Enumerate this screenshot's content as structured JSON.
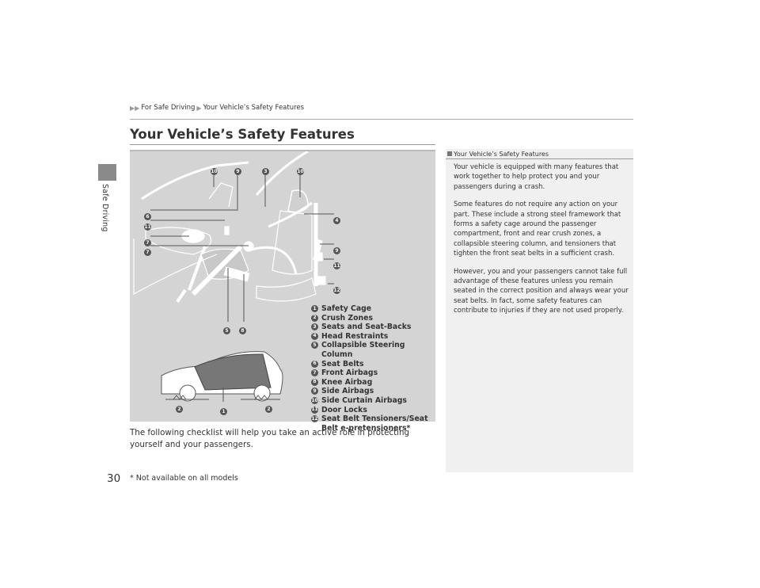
{
  "sidebar": {
    "section_label": "Safe Driving"
  },
  "breadcrumb": {
    "items": [
      "For Safe Driving",
      "Your Vehicle’s Safety Features"
    ]
  },
  "page": {
    "title": "Your Vehicle’s Safety Features",
    "number": "30"
  },
  "figure": {
    "callouts_top": [
      "10",
      "9",
      "3",
      "10"
    ],
    "callouts_left": [
      "6",
      "11",
      "7",
      "7"
    ],
    "callouts_right": [
      "4",
      "9",
      "11",
      "12"
    ],
    "callouts_bottom": [
      "5",
      "8"
    ],
    "car_callouts": [
      "2",
      "1",
      "2"
    ],
    "legend": [
      {
        "num": "1",
        "label": "Safety Cage"
      },
      {
        "num": "2",
        "label": "Crush Zones"
      },
      {
        "num": "3",
        "label": "Seats and Seat-Backs"
      },
      {
        "num": "4",
        "label": "Head Restraints"
      },
      {
        "num": "5",
        "label": "Collapsible Steering Column"
      },
      {
        "num": "6",
        "label": "Seat Belts"
      },
      {
        "num": "7",
        "label": "Front Airbags"
      },
      {
        "num": "8",
        "label": "Knee Airbag"
      },
      {
        "num": "9",
        "label": "Side Airbags"
      },
      {
        "num": "10",
        "label": "Side Curtain Airbags"
      },
      {
        "num": "11",
        "label": "Door Locks"
      },
      {
        "num": "12",
        "label": "Seat Belt Tensioners/Seat Belt e-pretensioners*"
      }
    ]
  },
  "body": {
    "text": "The following checklist will help you take an active role in protecting yourself and your passengers."
  },
  "footnote": "* Not available on all models",
  "side_panel": {
    "heading": "Your Vehicle’s Safety Features",
    "paragraphs": [
      "Your vehicle is equipped with many features that work together to help protect you and your passengers during a crash.",
      "Some features do not require any action on your part. These include a strong steel framework that forms a safety cage around the passenger compartment, front and rear crush zones, a collapsible steering column, and tensioners that tighten the front seat belts in a sufficient crash.",
      "However, you and your passengers cannot take full advantage of these features unless you remain seated in the correct position and always wear your seat belts. In fact, some safety features can contribute to injuries if they are not used properly."
    ]
  }
}
